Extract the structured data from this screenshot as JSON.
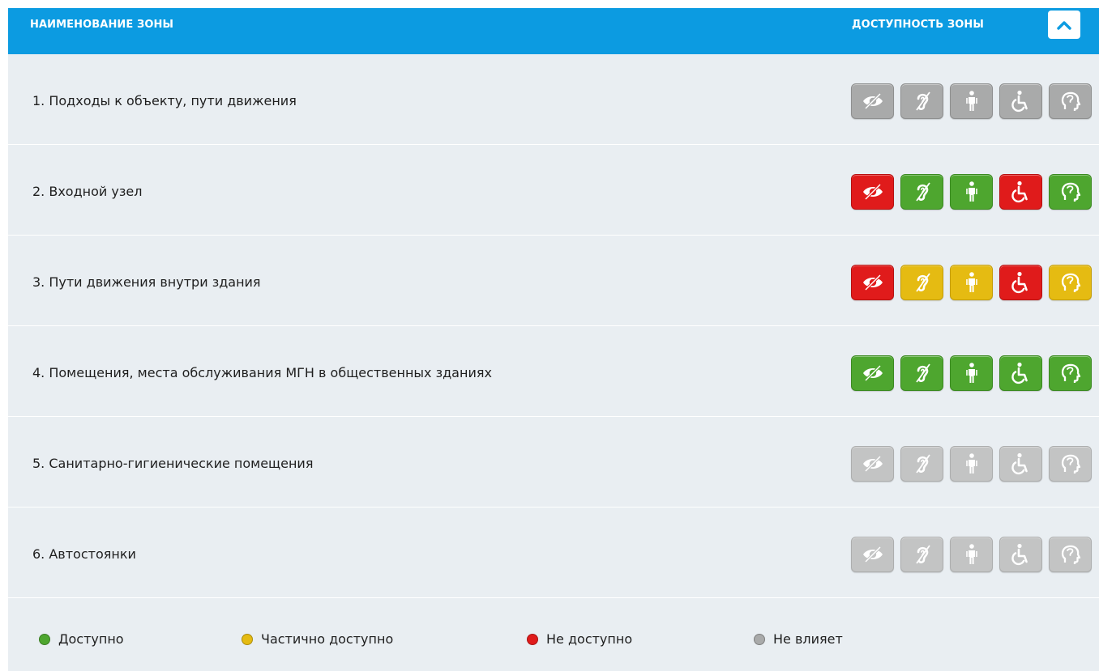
{
  "header": {
    "zone_name_label": "НАИМЕНОВАНИЕ ЗОНЫ",
    "zone_access_label": "ДОСТУПНОСТЬ ЗОНЫ",
    "collapse_icon": "chevron-up-icon"
  },
  "categories": [
    {
      "key": "vision",
      "icon": "vision-impaired-icon"
    },
    {
      "key": "hearing",
      "icon": "hearing-impaired-icon"
    },
    {
      "key": "mobility",
      "icon": "standing-person-icon"
    },
    {
      "key": "wheelchair",
      "icon": "wheelchair-icon"
    },
    {
      "key": "mental",
      "icon": "mental-impairment-icon"
    }
  ],
  "zones": [
    {
      "label": "1. Подходы к объекту, пути движения",
      "status": [
        "gray",
        "gray",
        "gray",
        "gray",
        "gray"
      ]
    },
    {
      "label": "2. Входной узел",
      "status": [
        "red",
        "green",
        "green",
        "red",
        "green"
      ]
    },
    {
      "label": "3. Пути движения внутри здания",
      "status": [
        "red",
        "yellow",
        "yellow",
        "red",
        "yellow"
      ]
    },
    {
      "label": "4. Помещения, места обслуживания МГН в общественных зданиях",
      "status": [
        "green",
        "green",
        "green",
        "green",
        "green"
      ]
    },
    {
      "label": "5. Санитарно-гигиенические помещения",
      "status": [
        "light",
        "light",
        "light",
        "light",
        "light"
      ]
    },
    {
      "label": "6. Автостоянки",
      "status": [
        "light",
        "light",
        "light",
        "light",
        "light"
      ]
    }
  ],
  "legend": [
    {
      "label": "Доступно",
      "color": "#4ea62f"
    },
    {
      "label": "Частично доступно",
      "color": "#e5bb12"
    },
    {
      "label": "Не доступно",
      "color": "#e01b1b"
    },
    {
      "label": "Не влияет",
      "color": "#a9aaaa"
    }
  ],
  "colors": {
    "header_bg": "#0c9be1",
    "panel_bg": "#e9eef2"
  }
}
